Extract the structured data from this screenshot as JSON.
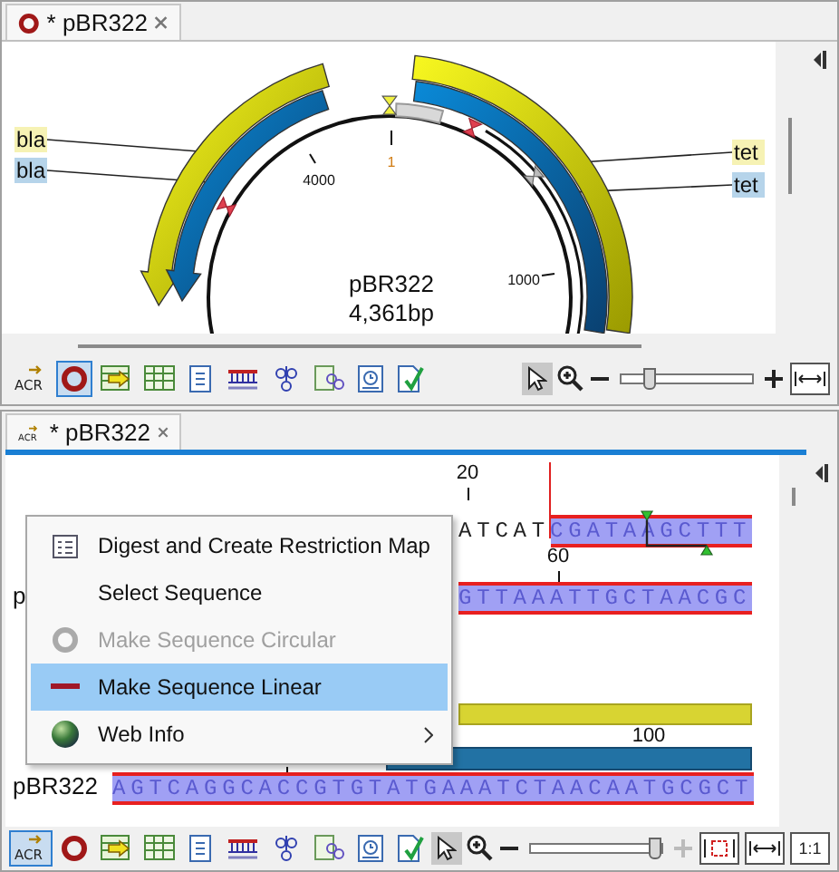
{
  "top_view": {
    "tab": {
      "label": "* pBR322",
      "kind": "circular"
    },
    "map": {
      "name": "pBR322",
      "length": "4,361bp",
      "ticks": [
        "4000",
        "1",
        "1000"
      ],
      "features": [
        {
          "label": "bla",
          "kind": "gene"
        },
        {
          "label": "bla",
          "kind": "cds"
        },
        {
          "label": "tet",
          "kind": "gene"
        },
        {
          "label": "tet",
          "kind": "cds"
        }
      ]
    },
    "toolbar": {
      "views": [
        {
          "kind": "sequence",
          "text": "ACR",
          "selected": false
        },
        {
          "kind": "circular",
          "selected": true
        },
        {
          "kind": "annotation-table",
          "selected": false
        },
        {
          "kind": "table",
          "selected": false
        },
        {
          "kind": "text",
          "selected": false
        },
        {
          "kind": "restriction",
          "selected": false
        },
        {
          "kind": "structure",
          "selected": false
        },
        {
          "kind": "structure-table",
          "selected": false
        },
        {
          "kind": "history",
          "selected": false
        },
        {
          "kind": "element-info",
          "selected": false
        }
      ],
      "zoom": {
        "level": 0.18,
        "plus_disabled": false
      },
      "fit": [
        {
          "kind": "fit-width"
        }
      ]
    }
  },
  "bottom_view": {
    "tab": {
      "label": "* pBR322",
      "kind": "sequence",
      "text": "ACR"
    },
    "ruler": [
      "20",
      "60",
      "100"
    ],
    "rows": [
      {
        "segments": [
          {
            "text": "ATCAT",
            "selected": false
          },
          {
            "text": "CGATAAGCTTT",
            "selected": true
          }
        ]
      },
      {
        "name": "p",
        "segments": [
          {
            "text": "GTTAAATTGCTAACGC",
            "selected": true
          }
        ]
      },
      {
        "name": "pBR322",
        "segments": [
          {
            "text": "AGTCAGGCACCGTGTATGAAATCTAACAATGCGCT",
            "selected": true
          }
        ]
      }
    ],
    "annotations": [
      {
        "kind": "gene"
      },
      {
        "kind": "cds"
      }
    ],
    "menu": [
      {
        "kind": "digest",
        "label": "Digest and Create Restriction Map",
        "disabled": false,
        "selected": false
      },
      {
        "kind": "plain",
        "label": "Select Sequence",
        "disabled": false,
        "selected": false
      },
      {
        "kind": "circular",
        "label": "Make Sequence Circular",
        "disabled": true,
        "selected": false
      },
      {
        "kind": "linear",
        "label": "Make Sequence Linear",
        "disabled": false,
        "selected": true
      },
      {
        "kind": "web",
        "label": "Web Info",
        "disabled": false,
        "selected": false,
        "submenu": true
      }
    ],
    "toolbar": {
      "views": [
        {
          "kind": "sequence",
          "text": "ACR",
          "selected": true
        },
        {
          "kind": "circular",
          "selected": false
        },
        {
          "kind": "annotation-table",
          "selected": false
        },
        {
          "kind": "table",
          "selected": false
        },
        {
          "kind": "text",
          "selected": false
        },
        {
          "kind": "restriction",
          "selected": false
        },
        {
          "kind": "structure",
          "selected": false
        },
        {
          "kind": "structure-table",
          "selected": false
        },
        {
          "kind": "history",
          "selected": false
        },
        {
          "kind": "element-info",
          "selected": false
        }
      ],
      "zoom": {
        "level": 0.97,
        "plus_disabled": true
      },
      "fit": [
        {
          "kind": "fit-selection"
        },
        {
          "kind": "fit-width"
        },
        {
          "kind": "one-to-one",
          "text": "1:1"
        }
      ]
    }
  }
}
